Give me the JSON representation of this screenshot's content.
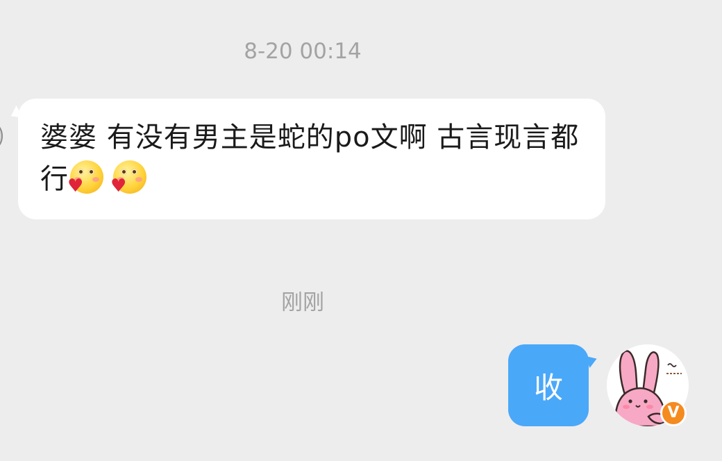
{
  "conversation": {
    "timestamps": {
      "first": "8-20 00:14",
      "second": "刚刚"
    },
    "incoming_message": {
      "text": "婆婆 有没有男主是蛇的po文啊 古言现言都行",
      "emojis": [
        "blushing-heart-emoji",
        "blushing-heart-emoji"
      ]
    },
    "outgoing_message": {
      "text": "收"
    },
    "my_avatar": {
      "icon": "pink-bunny-avatar",
      "badge_icon": "verified-v-badge",
      "badge_text": "V",
      "badge_color": "#f58a1f"
    }
  },
  "colors": {
    "background": "#ededed",
    "incoming_bubble": "#ffffff",
    "outgoing_bubble": "#4aa8f9",
    "timestamp_text": "#a3a3a3"
  }
}
